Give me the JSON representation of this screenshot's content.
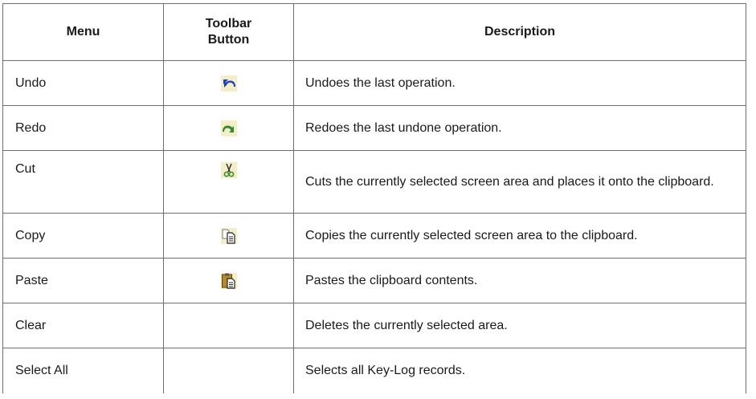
{
  "table": {
    "headers": {
      "menu": "Menu",
      "toolbar_line1": "Toolbar",
      "toolbar_line2": "Button",
      "description": "Description"
    },
    "rows": [
      {
        "menu": "Undo",
        "icon": "undo-icon",
        "description": "Undoes the last operation."
      },
      {
        "menu": "Redo",
        "icon": "redo-icon",
        "description": "Redoes the last undone operation."
      },
      {
        "menu": "Cut",
        "icon": "scissors-icon",
        "description": "Cuts the currently selected screen area and places it onto the clipboard."
      },
      {
        "menu": "Copy",
        "icon": "copy-icon",
        "description": "Copies the currently selected screen area to the clipboard."
      },
      {
        "menu": "Paste",
        "icon": "paste-icon",
        "description": "Pastes the clipboard contents."
      },
      {
        "menu": "Clear",
        "icon": "",
        "description": "Deletes the currently selected area."
      },
      {
        "menu": "Select All",
        "icon": "",
        "description": "Selects all Key-Log records."
      }
    ]
  },
  "colors": {
    "undo_arrow": "#1a3fc4",
    "redo_arrow": "#2e8b2e",
    "icon_background": "#f3edc8",
    "scissors_green": "#3a8f2a",
    "border": "#6e6e6e"
  }
}
